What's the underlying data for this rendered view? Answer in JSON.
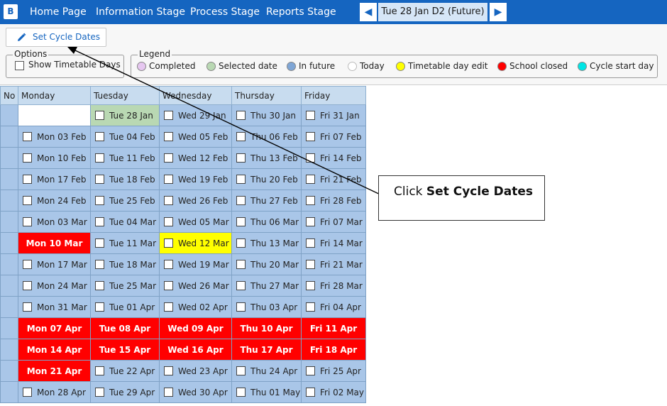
{
  "nav": {
    "logo": "B",
    "items": [
      "Home Page",
      "Information Stage",
      "Process Stage",
      "Reports Stage"
    ],
    "date_prev_icon": "triangle-left",
    "date_next_icon": "triangle-right",
    "current_date": "Tue 28 Jan D2 (Future)"
  },
  "toolbar": {
    "set_cycle_label": "Set Cycle Dates",
    "set_cycle_icon": "pencil-icon"
  },
  "options": {
    "title": "Options",
    "show_timetable_days": "Show Timetable Days"
  },
  "legend": {
    "title": "Legend",
    "items": [
      {
        "label": "Completed",
        "color": "#e6c7f0"
      },
      {
        "label": "Selected date",
        "color": "#b9d8b3"
      },
      {
        "label": "In future",
        "color": "#7fa6d6"
      },
      {
        "label": "Today",
        "color": "#ffffff"
      },
      {
        "label": "Timetable day edit",
        "color": "#ffff00"
      },
      {
        "label": "School closed",
        "color": "#ff0000"
      },
      {
        "label": "Cycle start day",
        "color": "#00e5e5"
      }
    ]
  },
  "grid": {
    "headers": [
      "No",
      "Monday",
      "Tuesday",
      "Wednesday",
      "Thursday",
      "Friday"
    ],
    "rows": [
      [
        {
          "t": "",
          "s": "empty"
        },
        {
          "t": "Tue 28 Jan",
          "s": "selected"
        },
        {
          "t": "Wed 29 Jan",
          "s": "future"
        },
        {
          "t": "Thu 30 Jan",
          "s": "future"
        },
        {
          "t": "Fri 31 Jan",
          "s": "future"
        }
      ],
      [
        {
          "t": "Mon 03 Feb",
          "s": "future"
        },
        {
          "t": "Tue 04 Feb",
          "s": "future"
        },
        {
          "t": "Wed 05 Feb",
          "s": "future"
        },
        {
          "t": "Thu 06 Feb",
          "s": "future"
        },
        {
          "t": "Fri 07 Feb",
          "s": "future"
        }
      ],
      [
        {
          "t": "Mon 10 Feb",
          "s": "future"
        },
        {
          "t": "Tue 11 Feb",
          "s": "future"
        },
        {
          "t": "Wed 12 Feb",
          "s": "future"
        },
        {
          "t": "Thu 13 Feb",
          "s": "future"
        },
        {
          "t": "Fri 14 Feb",
          "s": "future"
        }
      ],
      [
        {
          "t": "Mon 17 Feb",
          "s": "future"
        },
        {
          "t": "Tue 18 Feb",
          "s": "future"
        },
        {
          "t": "Wed 19 Feb",
          "s": "future"
        },
        {
          "t": "Thu 20 Feb",
          "s": "future"
        },
        {
          "t": "Fri 21 Feb",
          "s": "future"
        }
      ],
      [
        {
          "t": "Mon 24 Feb",
          "s": "future"
        },
        {
          "t": "Tue 25 Feb",
          "s": "future"
        },
        {
          "t": "Wed 26 Feb",
          "s": "future"
        },
        {
          "t": "Thu 27 Feb",
          "s": "future"
        },
        {
          "t": "Fri 28 Feb",
          "s": "future"
        }
      ],
      [
        {
          "t": "Mon 03 Mar",
          "s": "future"
        },
        {
          "t": "Tue 04 Mar",
          "s": "future"
        },
        {
          "t": "Wed 05 Mar",
          "s": "future"
        },
        {
          "t": "Thu 06 Mar",
          "s": "future"
        },
        {
          "t": "Fri 07 Mar",
          "s": "future"
        }
      ],
      [
        {
          "t": "Mon 10 Mar",
          "s": "closed"
        },
        {
          "t": "Tue 11 Mar",
          "s": "future"
        },
        {
          "t": "Wed 12 Mar",
          "s": "edit"
        },
        {
          "t": "Thu 13 Mar",
          "s": "future"
        },
        {
          "t": "Fri 14 Mar",
          "s": "future"
        }
      ],
      [
        {
          "t": "Mon 17 Mar",
          "s": "future"
        },
        {
          "t": "Tue 18 Mar",
          "s": "future"
        },
        {
          "t": "Wed 19 Mar",
          "s": "future"
        },
        {
          "t": "Thu 20 Mar",
          "s": "future"
        },
        {
          "t": "Fri 21 Mar",
          "s": "future"
        }
      ],
      [
        {
          "t": "Mon 24 Mar",
          "s": "future"
        },
        {
          "t": "Tue 25 Mar",
          "s": "future"
        },
        {
          "t": "Wed 26 Mar",
          "s": "future"
        },
        {
          "t": "Thu 27 Mar",
          "s": "future"
        },
        {
          "t": "Fri 28 Mar",
          "s": "future"
        }
      ],
      [
        {
          "t": "Mon 31 Mar",
          "s": "future"
        },
        {
          "t": "Tue 01 Apr",
          "s": "future"
        },
        {
          "t": "Wed 02 Apr",
          "s": "future"
        },
        {
          "t": "Thu 03 Apr",
          "s": "future"
        },
        {
          "t": "Fri 04 Apr",
          "s": "future"
        }
      ],
      [
        {
          "t": "Mon 07 Apr",
          "s": "closed"
        },
        {
          "t": "Tue 08 Apr",
          "s": "closed"
        },
        {
          "t": "Wed 09 Apr",
          "s": "closed"
        },
        {
          "t": "Thu 10 Apr",
          "s": "closed"
        },
        {
          "t": "Fri 11 Apr",
          "s": "closed"
        }
      ],
      [
        {
          "t": "Mon 14 Apr",
          "s": "closed"
        },
        {
          "t": "Tue 15 Apr",
          "s": "closed"
        },
        {
          "t": "Wed 16 Apr",
          "s": "closed"
        },
        {
          "t": "Thu 17 Apr",
          "s": "closed"
        },
        {
          "t": "Fri 18 Apr",
          "s": "closed"
        }
      ],
      [
        {
          "t": "Mon 21 Apr",
          "s": "closed"
        },
        {
          "t": "Tue 22 Apr",
          "s": "future"
        },
        {
          "t": "Wed 23 Apr",
          "s": "future"
        },
        {
          "t": "Thu 24 Apr",
          "s": "future"
        },
        {
          "t": "Fri 25 Apr",
          "s": "future"
        }
      ],
      [
        {
          "t": "Mon 28 Apr",
          "s": "future"
        },
        {
          "t": "Tue 29 Apr",
          "s": "future"
        },
        {
          "t": "Wed 30 Apr",
          "s": "future"
        },
        {
          "t": "Thu 01 May",
          "s": "future"
        },
        {
          "t": "Fri 02 May",
          "s": "future"
        }
      ]
    ]
  },
  "annotation": {
    "prefix": "Click ",
    "bold": "Set Cycle Dates"
  }
}
